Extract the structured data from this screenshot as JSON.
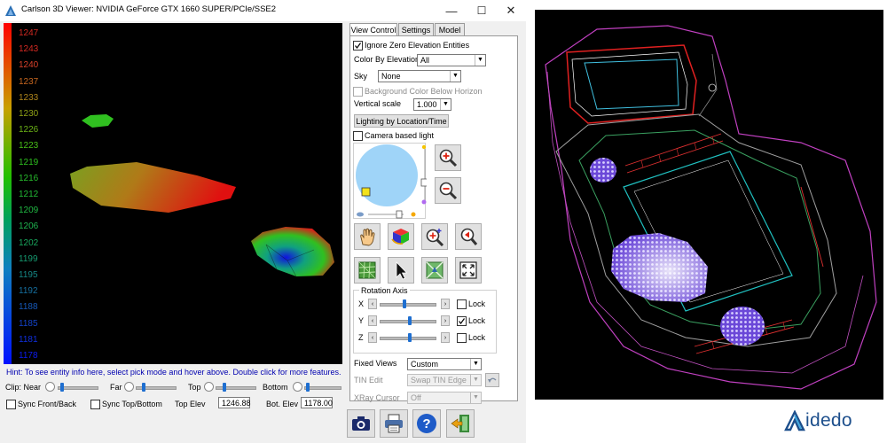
{
  "window": {
    "title": "Carlson 3D Viewer: NVIDIA GeForce GTX 1660 SUPER/PCIe/SSE2",
    "minimize_glyph": "—",
    "maximize_glyph": "☐",
    "close_glyph": "✕"
  },
  "elevation_legend": [
    "1247",
    "1243",
    "1240",
    "1237",
    "1233",
    "1230",
    "1226",
    "1223",
    "1219",
    "1216",
    "1212",
    "1209",
    "1206",
    "1202",
    "1199",
    "1195",
    "1192",
    "1188",
    "1185",
    "1181",
    "1178"
  ],
  "elevation_colors": [
    "#d42a22",
    "#d42a22",
    "#d8402a",
    "#c7661f",
    "#b0861c",
    "#8fa116",
    "#6bb316",
    "#48bf18",
    "#2ec01f",
    "#27bd2c",
    "#22bb36",
    "#20b943",
    "#1fb650",
    "#1aa85e",
    "#169a70",
    "#168887",
    "#1670a0",
    "#1658b8",
    "#1444cc",
    "#1030de",
    "#0c1cf0"
  ],
  "hint": "Hint: To see entity info here, select pick mode and hover above. Double click for more features.",
  "clip_controls": {
    "near_label": "Clip: Near",
    "far_label": "Far",
    "top_label": "Top",
    "bottom_label": "Bottom"
  },
  "sync": {
    "front_back": "Sync Front/Back",
    "top_bottom": "Sync Top/Bottom"
  },
  "elevations": {
    "top_label": "Top Elev",
    "top_value": "1246.88",
    "bot_label": "Bot. Elev",
    "bot_value": "1178.00"
  },
  "tabs": [
    "View Control",
    "Settings",
    "Model"
  ],
  "view_control": {
    "ignore_zero": "Ignore Zero Elevation Entities",
    "color_by_elevation_label": "Color By Elevation",
    "color_by_elevation_value": "All",
    "sky_label": "Sky",
    "sky_value": "None",
    "bg_below_horizon": "Background Color Below Horizon",
    "vertical_scale_label": "Vertical scale",
    "vertical_scale_value": "1.000",
    "lighting_button": "Lighting by Location/Time",
    "camera_light": "Camera based light",
    "rotation_axis": "Rotation Axis",
    "axes": [
      {
        "name": "X",
        "lock": "Lock",
        "locked": false
      },
      {
        "name": "Y",
        "lock": "Lock",
        "locked": true
      },
      {
        "name": "Z",
        "lock": "Lock",
        "locked": false
      }
    ],
    "fixed_views_label": "Fixed Views",
    "fixed_views_value": "Custom",
    "tin_edit_label": "TIN Edit",
    "tin_edit_value": "Swap TIN Edge",
    "xray_label": "XRay Cursor",
    "xray_value": "Off"
  },
  "tools": [
    "pan-hand",
    "color-cube",
    "zoom-in-plus",
    "zoom-back",
    "tin-grid",
    "pointer-arrow",
    "map-view",
    "fit-extents"
  ],
  "bottom_buttons": [
    "camera",
    "printer",
    "help",
    "exit"
  ],
  "brand": "idedo"
}
